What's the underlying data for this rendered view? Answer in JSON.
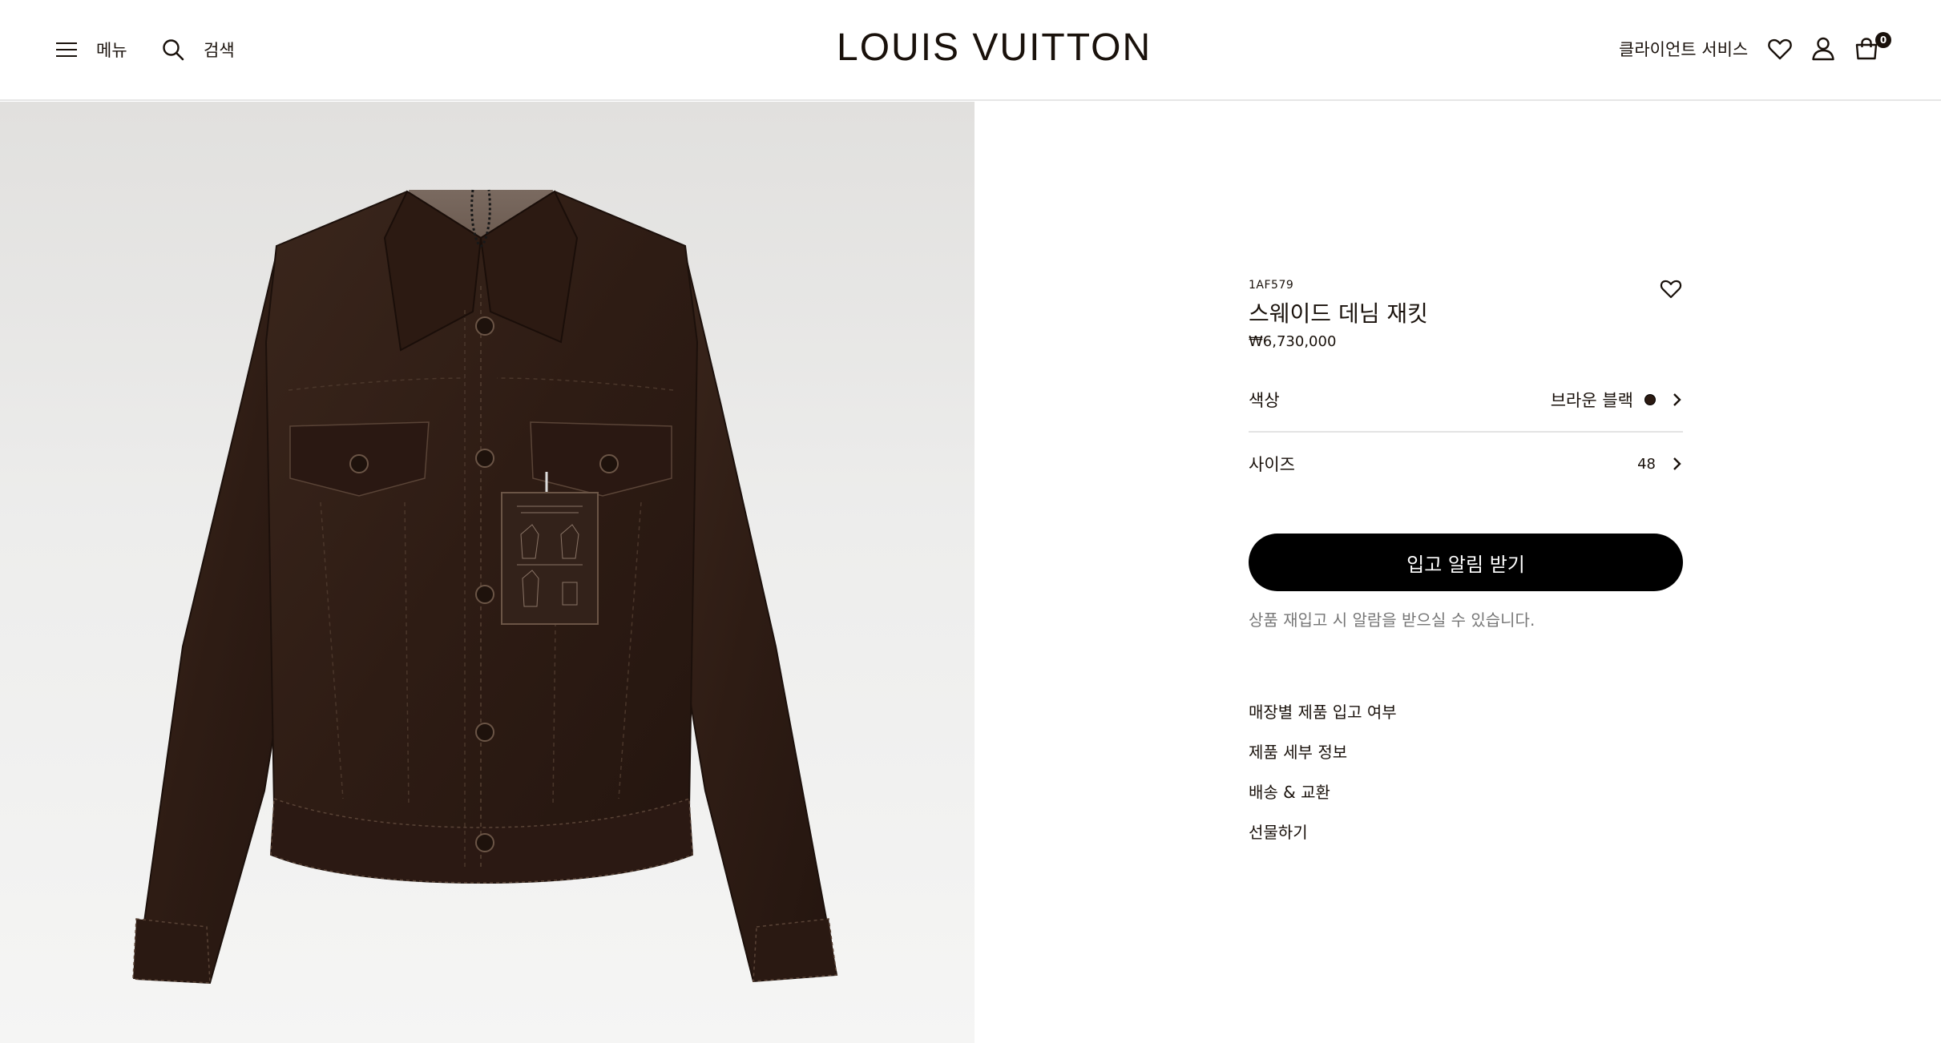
{
  "header": {
    "menu_label": "메뉴",
    "search_label": "검색",
    "logo_text": "LOUIS VUITTON",
    "client_service_label": "클라이언트 서비스",
    "bag_count": "0"
  },
  "product": {
    "sku": "1AF579",
    "name": "스웨이드 데님 재킷",
    "price": "₩6,730,000",
    "color_label": "색상",
    "color_value": "브라운 블랙",
    "color_swatch": "#2b1a12",
    "size_label": "사이즈",
    "size_value": "48",
    "cta_label": "입고 알림 받기",
    "cta_note": "상품 재입고 시 알람을 받으실 수 있습니다.",
    "links": [
      "매장별 제품 입고 여부",
      "제품 세부 정보",
      "배송 & 교환",
      "선물하기"
    ]
  },
  "colors": {
    "text": "#19110b",
    "cta_bg": "#000000",
    "muted": "#767676"
  }
}
